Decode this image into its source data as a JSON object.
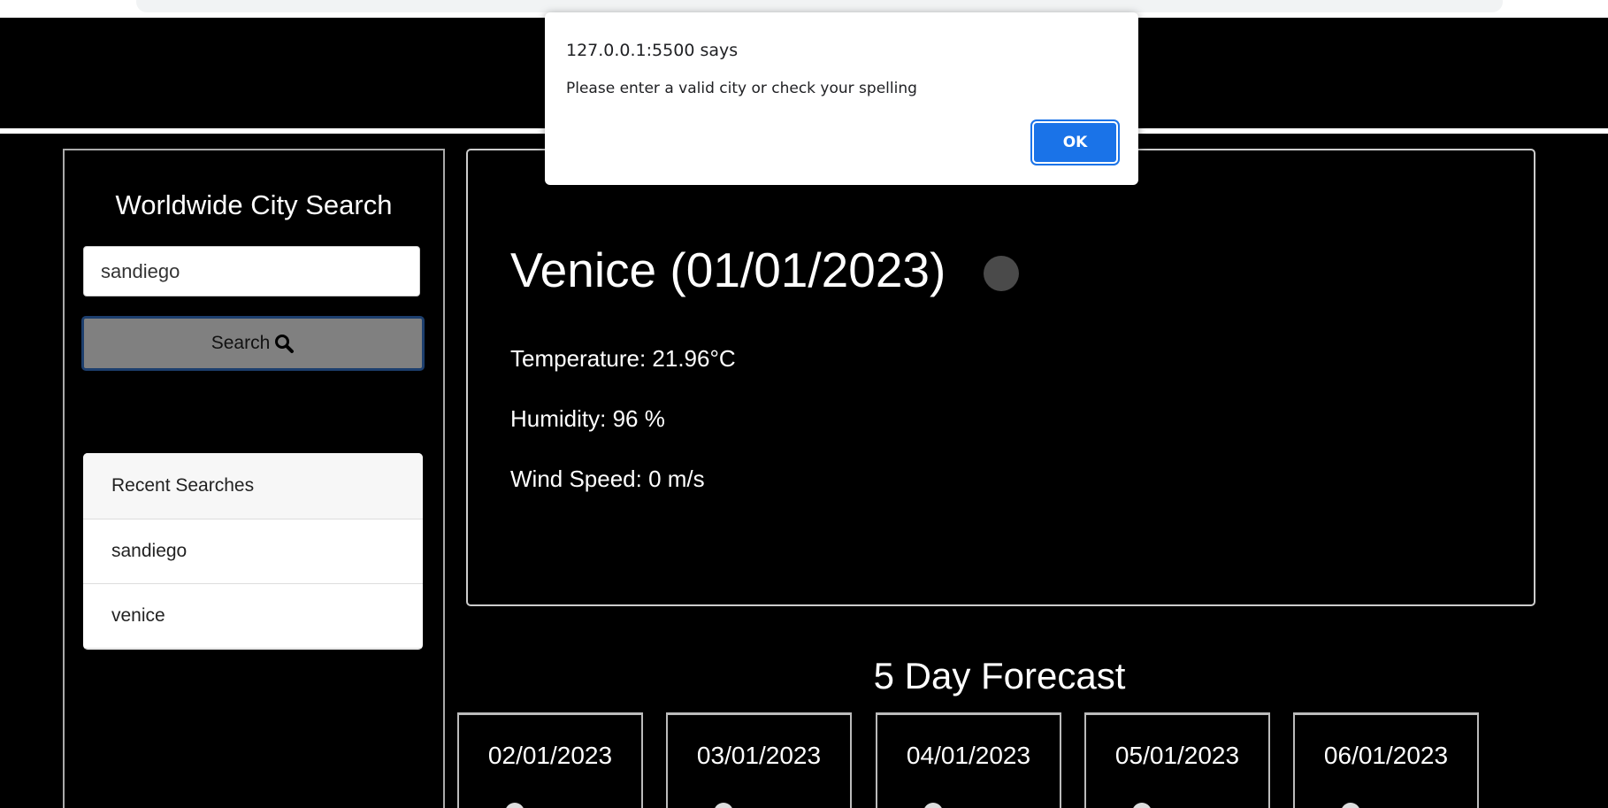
{
  "dialog": {
    "title": "127.0.0.1:5500 says",
    "message": "Please enter a valid city or check your spelling",
    "ok_label": "OK"
  },
  "sidebar": {
    "title": "Worldwide City Search",
    "search_value": "sandiego",
    "search_label": "Search",
    "recent_header": "Recent Searches",
    "recent": [
      "sandiego",
      "venice"
    ]
  },
  "current": {
    "heading": "Venice (01/01/2023)",
    "temperature": "Temperature: 21.96°C",
    "humidity": "Humidity: 96 %",
    "wind": "Wind Speed: 0 m/s"
  },
  "forecast": {
    "title": "5 Day Forecast",
    "days": [
      "02/01/2023",
      "03/01/2023",
      "04/01/2023",
      "05/01/2023",
      "06/01/2023"
    ]
  },
  "colors": {
    "button": "#808080",
    "ok": "#1a73e8"
  }
}
